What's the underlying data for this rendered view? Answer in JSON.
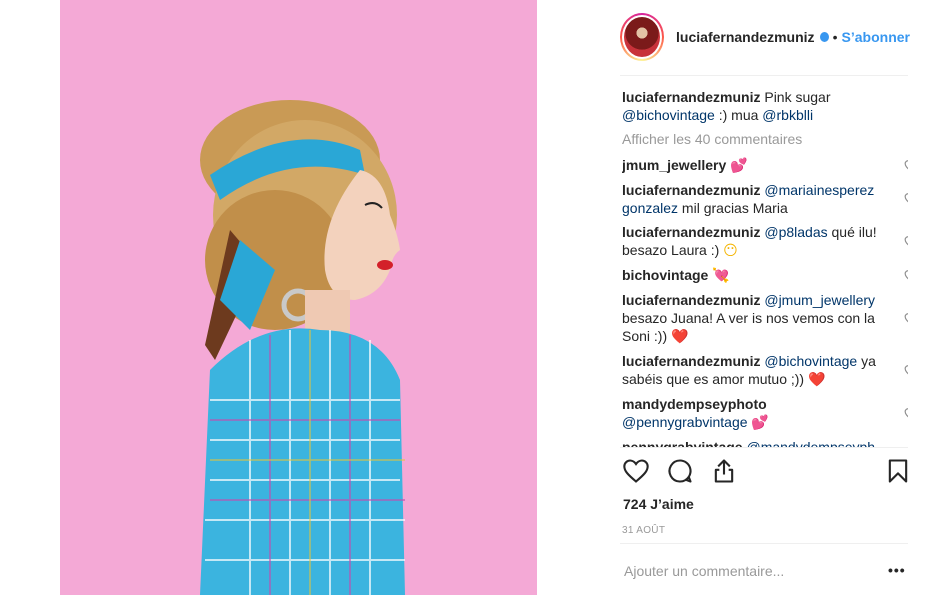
{
  "post": {
    "username": "luciafernandezmuniz",
    "separator": "•",
    "follow_label": "S’abonner"
  },
  "caption": {
    "username": "luciafernandezmuniz",
    "text_1": " Pink sugar ",
    "mention_1": "@bichovintage",
    "text_2": " :) mua ",
    "mention_2": "@rbkblli"
  },
  "view_all_comments": "Afficher les 40 commentaires",
  "comments": [
    {
      "username": "jmum_jewellery",
      "text": " ",
      "emoji": "💕"
    },
    {
      "username": "luciafernandezmuniz",
      "mention": "@mariainesperez gonzalez",
      "text": " mil gracias Maria"
    },
    {
      "username": "luciafernandezmuniz",
      "mention": "@p8ladas",
      "text": " qué ilu! besazo Laura :) ",
      "emoji": "😶"
    },
    {
      "username": "bichovintage",
      "text": " ",
      "emoji": "💘"
    },
    {
      "username": "luciafernandezmuniz",
      "mention": "@jmum_jewellery",
      "text": " besazo Juana! A ver is nos vemos con la Soni :)) ",
      "emoji": "❤️"
    },
    {
      "username": "luciafernandezmuniz",
      "mention": "@bichovintage",
      "text": " ya sabéis que es amor mutuo ;)) ",
      "emoji": "❤️"
    },
    {
      "username": "mandydempseyphoto",
      "mention": "@pennygrabvintage",
      "text": " ",
      "emoji": "💕"
    },
    {
      "username": "pennygrabvintage",
      "mention": "@mandydempseyph",
      "text": ""
    }
  ],
  "likes_count": "724 J’aime",
  "post_date": "31 AOÛT",
  "add_comment_placeholder": "Ajouter un commentaire...",
  "more_options": "•••",
  "icons": {
    "like": "heart-icon",
    "comment": "comment-icon",
    "share": "share-icon",
    "save": "bookmark-icon",
    "verified": "verified-badge-icon",
    "more": "more-options-icon"
  },
  "colors": {
    "link": "#3897f0",
    "mention": "#003569",
    "muted": "#999999",
    "photo_background": "#f4a9d6"
  }
}
